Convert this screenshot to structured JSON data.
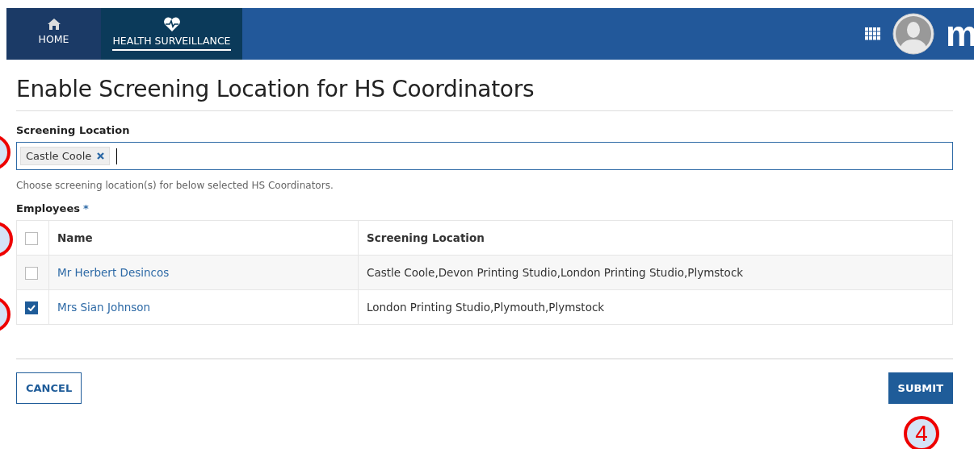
{
  "nav": {
    "items": [
      {
        "label": "HOME",
        "kind": "home",
        "selected": false
      },
      {
        "label": "HEALTH SURVEILLANCE",
        "kind": "health",
        "selected": true
      }
    ],
    "logo": "m"
  },
  "title": "Enable Screening Location for HS Coordinators",
  "screening_location": {
    "label": "Screening Location",
    "tags": [
      "Castle Coole"
    ],
    "help": "Choose screening location(s) for below selected HS Coordinators."
  },
  "employees": {
    "label": "Employees",
    "required_mark": "*",
    "select_all": {
      "checked": false
    },
    "columns": [
      "Name",
      "Screening Location"
    ],
    "rows": [
      {
        "name": "Mr Herbert Desincos",
        "location": "Castle Coole,Devon Printing Studio,London Printing Studio,Plymstock",
        "checked": false
      },
      {
        "name": "Mrs Sian Johnson",
        "location": "London Printing Studio,Plymouth,Plymstock",
        "checked": true
      }
    ]
  },
  "buttons": {
    "cancel": "CANCEL",
    "submit": "SUBMIT"
  },
  "callouts": [
    {
      "kind": "circle"
    },
    {
      "kind": "circle"
    },
    {
      "kind": "circle"
    },
    {
      "kind": "numbered",
      "number": "4"
    }
  ]
}
